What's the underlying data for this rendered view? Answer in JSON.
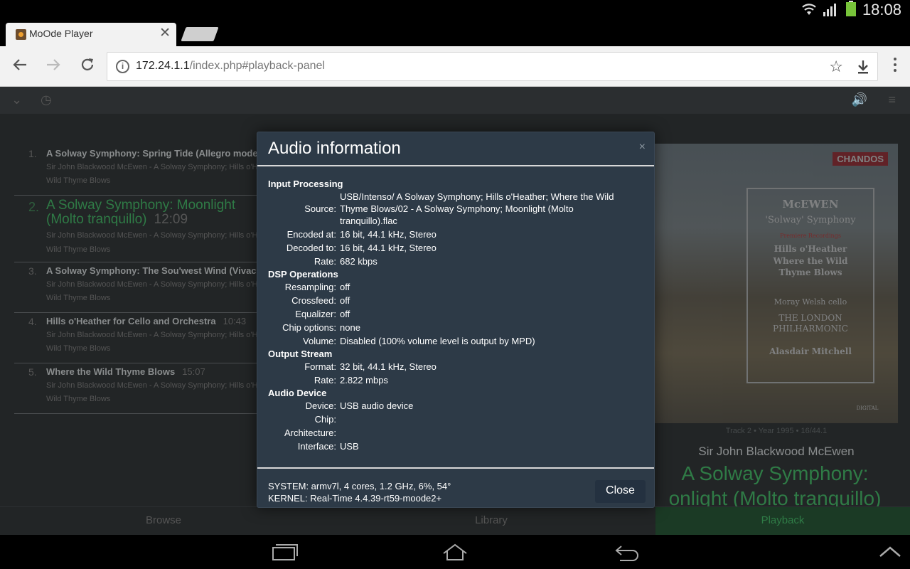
{
  "status": {
    "time": "18:08"
  },
  "browser": {
    "tab_title": "MoOde Player",
    "url_host": "172.24.1.1",
    "url_path": "/index.php#playback-panel"
  },
  "playlist": [
    {
      "num": "1.",
      "title": "A Solway Symphony: Spring Tide (Allegro moder",
      "duration": "",
      "artist": "Sir John Blackwood McEwen - A Solway Symphony; Hills o'Hea",
      "album": "Wild Thyme Blows"
    },
    {
      "num": "2.",
      "title": "A Solway Symphony: Moonlight (Molto tranquillo)",
      "duration": "12:09",
      "artist": "Sir John Blackwood McEwen - A Solway Symphony; Hills o'Hea",
      "album": "Wild Thyme Blows"
    },
    {
      "num": "3.",
      "title": "A Solway Symphony: The Sou'west Wind (Vivac",
      "duration": "",
      "artist": "Sir John Blackwood McEwen - A Solway Symphony; Hills o'Hea",
      "album": "Wild Thyme Blows"
    },
    {
      "num": "4.",
      "title": "Hills o'Heather for Cello and Orchestra",
      "duration": "10:43",
      "artist": "Sir John Blackwood McEwen - A Solway Symphony; Hills o'Hea",
      "album": "Wild Thyme Blows"
    },
    {
      "num": "5.",
      "title": "Where the Wild Thyme Blows",
      "duration": "15:07",
      "artist": "Sir John Blackwood McEwen - A Solway Symphony; Hills o'Hea",
      "album": "Wild Thyme Blows"
    }
  ],
  "cover": {
    "label": "CHANDOS",
    "composer": "McEWEN",
    "work": "'Solway' Symphony",
    "recording": "Premiere Recordings",
    "piece1": "Hills o'Heather",
    "piece2": "Where the Wild",
    "piece3": "Thyme Blows",
    "soloist": "Moray Welsh cello",
    "orch1": "THE LONDON",
    "orch2": "PHILHARMONIC",
    "conductor": "Alasdair Mitchell",
    "digital": "DIGITAL"
  },
  "now_playing": {
    "meta": "Track 2 • Year 1995 • 16/44.1",
    "artist": "Sir John Blackwood McEwen",
    "title_line1": "A Solway Symphony:",
    "title_line2": "onlight (Molto tranquillo)"
  },
  "bottom_nav": {
    "browse": "Browse",
    "library": "Library",
    "playback": "Playback"
  },
  "modal": {
    "title": "Audio information",
    "close_x": "×",
    "sections": {
      "input": "Input Processing",
      "dsp": "DSP Operations",
      "output": "Output Stream",
      "device": "Audio Device"
    },
    "labels": {
      "source": "Source:",
      "encoded": "Encoded at:",
      "decoded": "Decoded to:",
      "rate": "Rate:",
      "resampling": "Resampling:",
      "crossfeed": "Crossfeed:",
      "equalizer": "Equalizer:",
      "chip_options": "Chip options:",
      "volume": "Volume:",
      "format": "Format:",
      "out_rate": "Rate:",
      "device": "Device:",
      "chip": "Chip:",
      "architecture": "Architecture:",
      "interface": "Interface:"
    },
    "values": {
      "source_1": "USB/Intenso/ A Solway Symphony; Hills o'Heather; Where the Wild",
      "source_2": "Thyme Blows/02 - A Solway Symphony; Moonlight (Molto",
      "source_3": "tranquillo).flac",
      "encoded": "16 bit, 44.1 kHz, Stereo",
      "decoded": "16 bit, 44.1 kHz, Stereo",
      "rate": "682 kbps",
      "resampling": "off",
      "crossfeed": "off",
      "equalizer": "off",
      "chip_options": "none",
      "volume": "Disabled (100% volume level is output by MPD)",
      "format": "32 bit, 44.1 kHz, Stereo",
      "out_rate": "2.822 mbps",
      "device": "USB audio device",
      "chip": "",
      "architecture": "",
      "interface": "USB"
    },
    "system": "SYSTEM: armv7l, 4 cores, 1.2 GHz, 6%, 54°",
    "kernel": "KERNEL: Real-Time 4.4.39-rt59-moode2+",
    "close_button": "Close"
  }
}
